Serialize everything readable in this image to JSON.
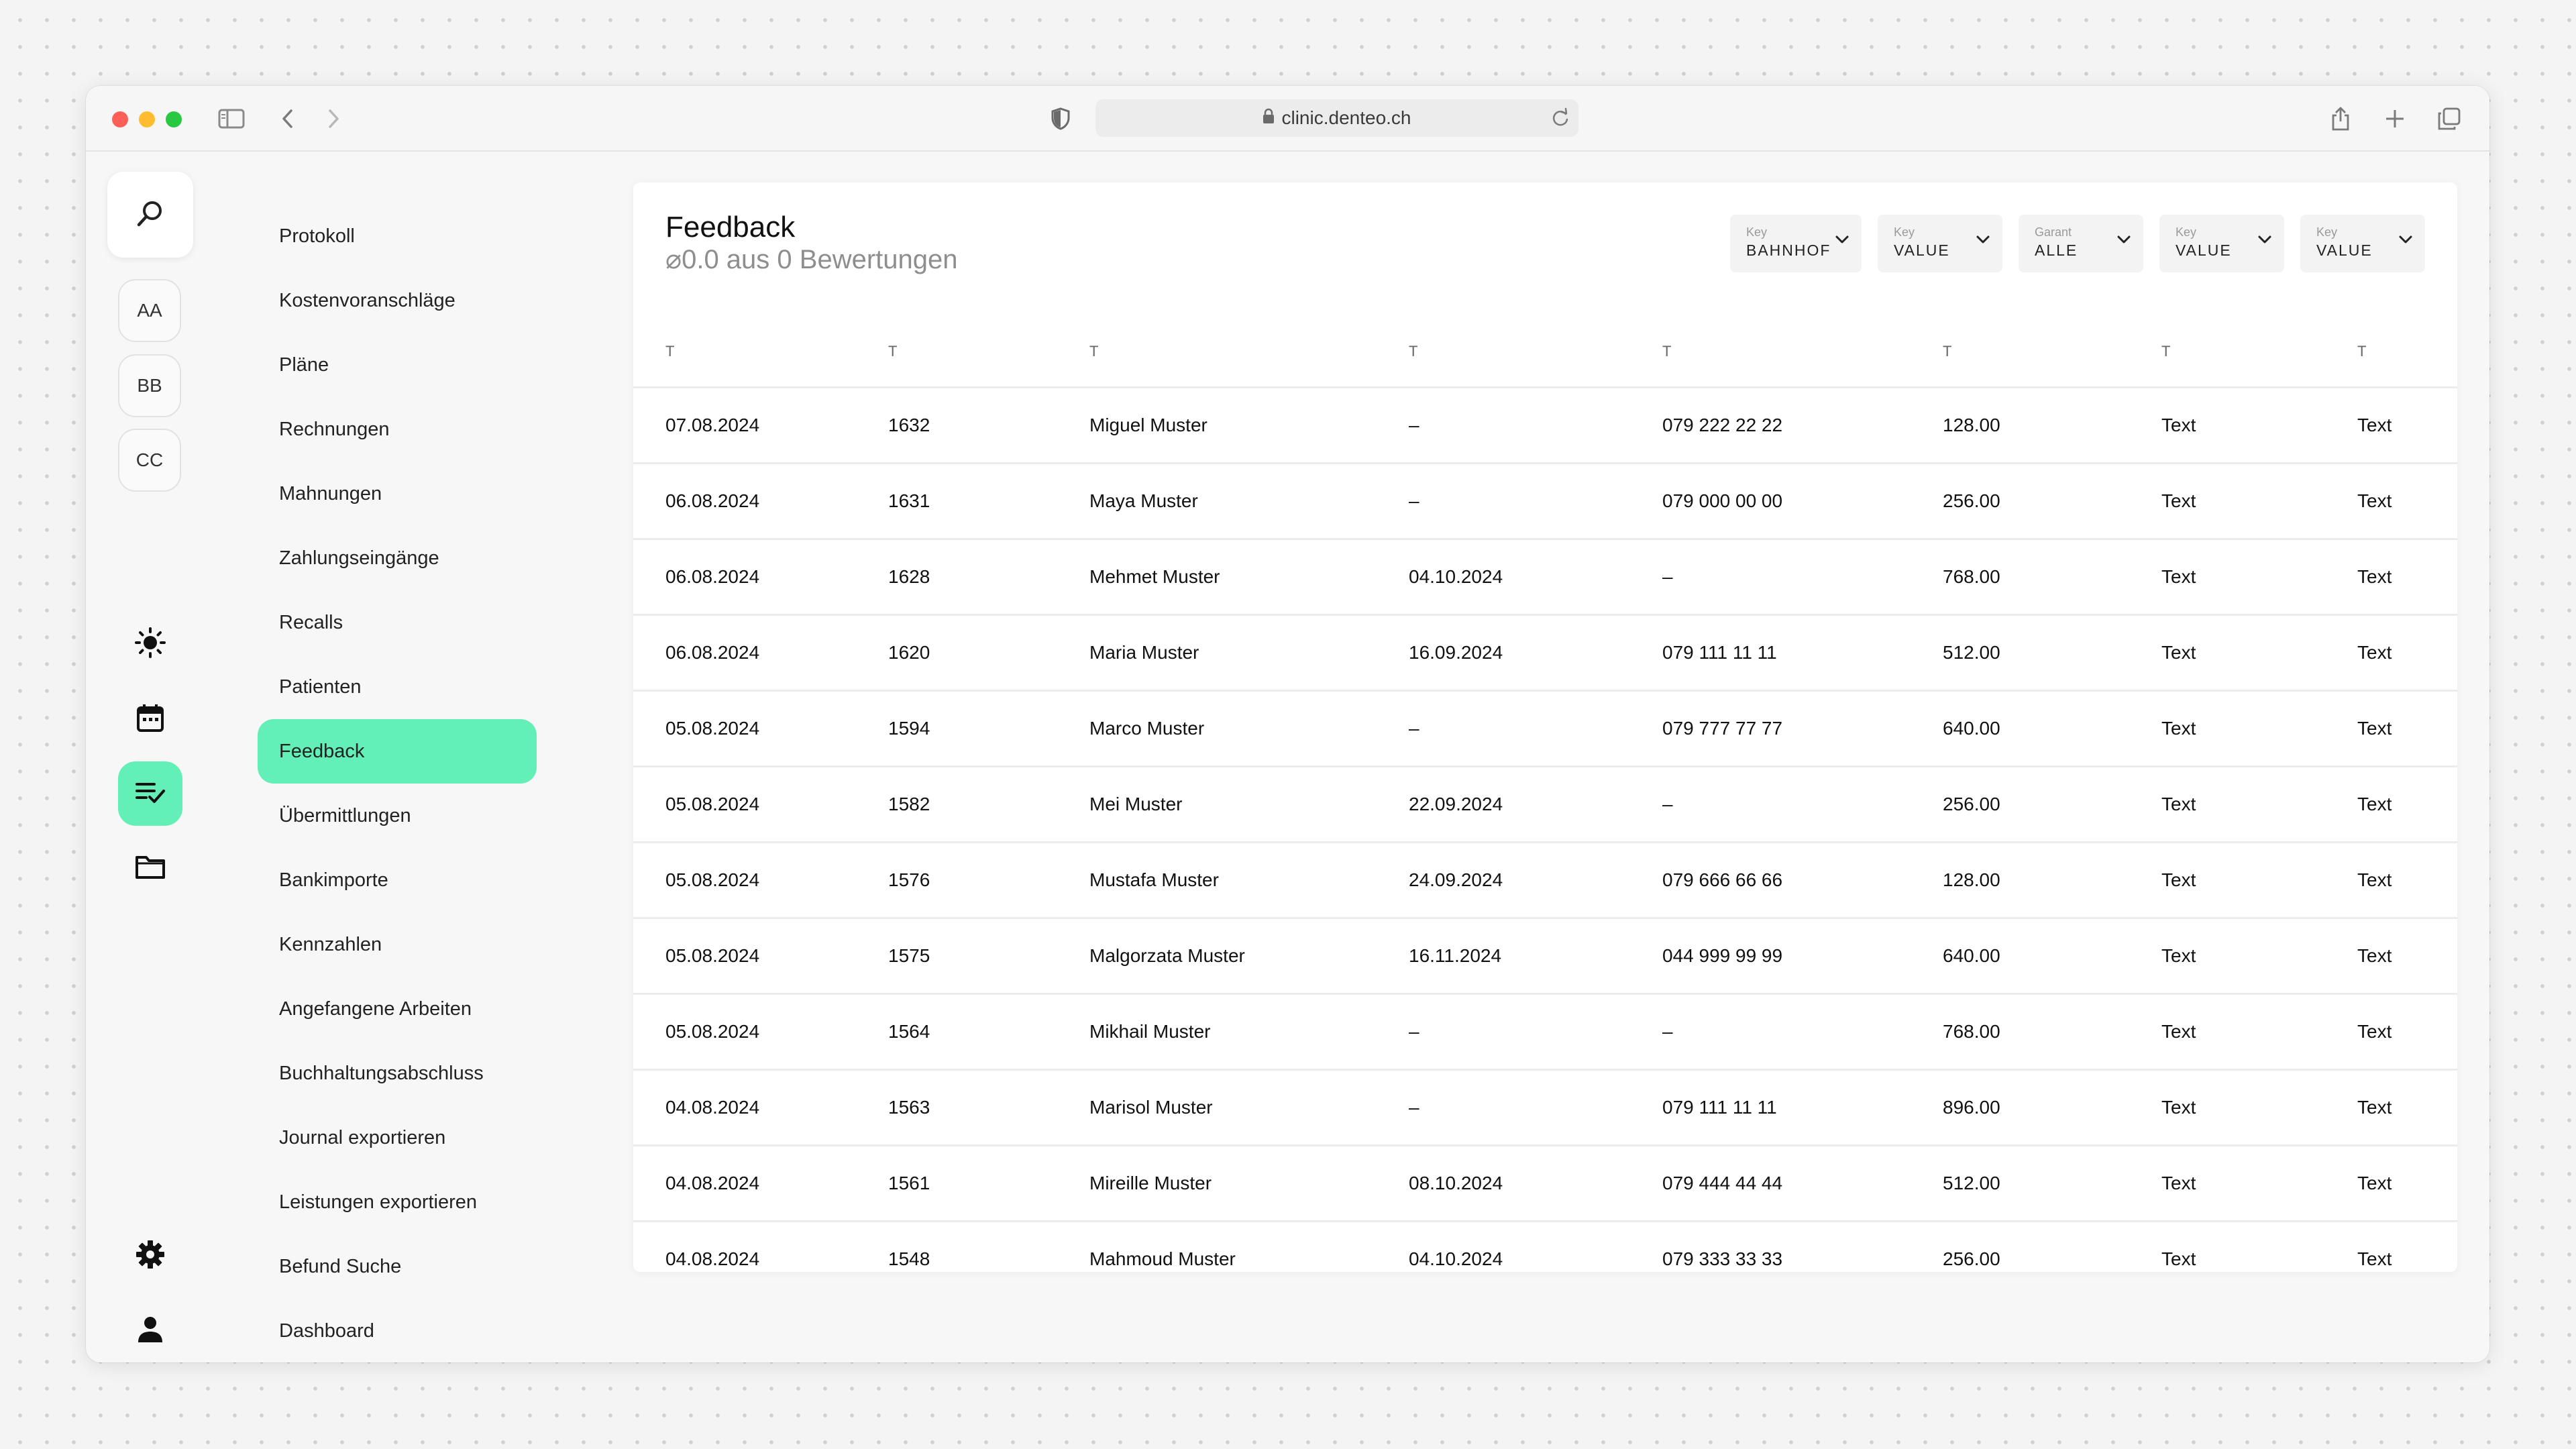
{
  "browser": {
    "url": "clinic.denteo.ch"
  },
  "rail": {
    "avatars": [
      "AA",
      "BB",
      "CC"
    ]
  },
  "nav": {
    "items": [
      "Protokoll",
      "Kostenvoranschläge",
      "Pläne",
      "Rechnungen",
      "Mahnungen",
      "Zahlungseingänge",
      "Recalls",
      "Patienten",
      "Feedback",
      "Übermittlungen",
      "Bankimporte",
      "Kennzahlen",
      "Angefangene Arbeiten",
      "Buchhaltungsabschluss",
      "Journal exportieren",
      "Leistungen exportieren",
      "Befund Suche",
      "Dashboard"
    ],
    "active": "Feedback"
  },
  "main": {
    "title": "Feedback",
    "subtitle": "⌀0.0 aus 0 Bewertungen",
    "filters": [
      {
        "key": "Key",
        "value": "BAHNHOF"
      },
      {
        "key": "Key",
        "value": "VALUE"
      },
      {
        "key": "Garant",
        "value": "ALLE"
      },
      {
        "key": "Key",
        "value": "VALUE"
      },
      {
        "key": "Key",
        "value": "VALUE"
      }
    ],
    "table": {
      "headers": [
        "T",
        "T",
        "T",
        "T",
        "T",
        "T",
        "T",
        "T"
      ],
      "rows": [
        [
          "07.08.2024",
          "1632",
          "Miguel Muster",
          "–",
          "079 222 22 22",
          "128.00",
          "Text",
          "Text"
        ],
        [
          "06.08.2024",
          "1631",
          "Maya Muster",
          "–",
          "079 000 00 00",
          "256.00",
          "Text",
          "Text"
        ],
        [
          "06.08.2024",
          "1628",
          "Mehmet Muster",
          "04.10.2024",
          "–",
          "768.00",
          "Text",
          "Text"
        ],
        [
          "06.08.2024",
          "1620",
          "Maria Muster",
          "16.09.2024",
          "079 111 11 11",
          "512.00",
          "Text",
          "Text"
        ],
        [
          "05.08.2024",
          "1594",
          "Marco Muster",
          "–",
          "079 777 77 77",
          "640.00",
          "Text",
          "Text"
        ],
        [
          "05.08.2024",
          "1582",
          "Mei Muster",
          "22.09.2024",
          "–",
          "256.00",
          "Text",
          "Text"
        ],
        [
          "05.08.2024",
          "1576",
          "Mustafa Muster",
          "24.09.2024",
          "079 666 66 66",
          "128.00",
          "Text",
          "Text"
        ],
        [
          "05.08.2024",
          "1575",
          "Malgorzata Muster",
          "16.11.2024",
          "044 999 99 99",
          "640.00",
          "Text",
          "Text"
        ],
        [
          "05.08.2024",
          "1564",
          "Mikhail Muster",
          "–",
          "–",
          "768.00",
          "Text",
          "Text"
        ],
        [
          "04.08.2024",
          "1563",
          "Marisol Muster",
          "–",
          "079 111 11 11",
          "896.00",
          "Text",
          "Text"
        ],
        [
          "04.08.2024",
          "1561",
          "Mireille Muster",
          "08.10.2024",
          "079 444 44 44",
          "512.00",
          "Text",
          "Text"
        ],
        [
          "04.08.2024",
          "1548",
          "Mahmoud Muster",
          "04.10.2024",
          "079 333 33 33",
          "256.00",
          "Text",
          "Text"
        ]
      ]
    }
  },
  "colors": {
    "accent": "#62f0b6"
  }
}
